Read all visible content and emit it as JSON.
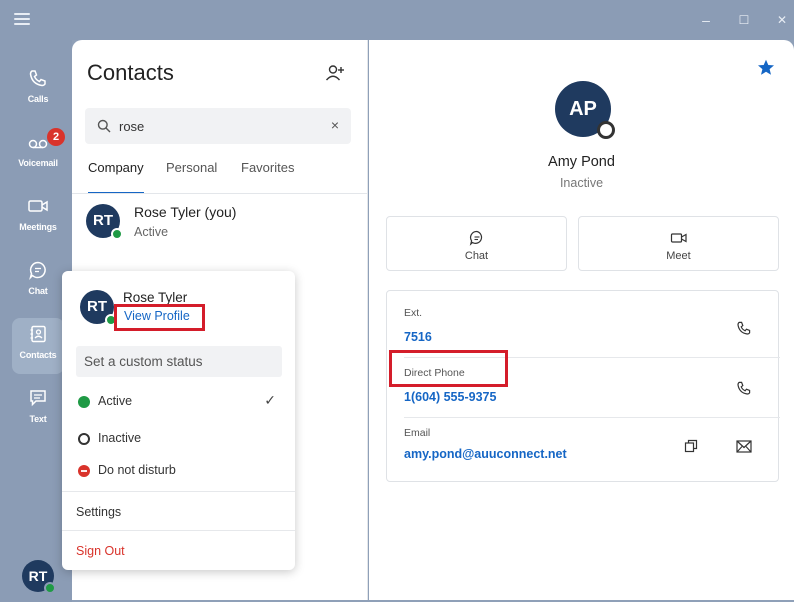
{
  "window": {
    "controls": {
      "minimize": "–",
      "maximize": "☐",
      "close": "✕"
    }
  },
  "rail": {
    "items": [
      {
        "label": "Calls",
        "icon": "phone-icon"
      },
      {
        "label": "Voicemail",
        "icon": "voicemail-icon",
        "badge": "2"
      },
      {
        "label": "Meetings",
        "icon": "video-icon"
      },
      {
        "label": "Chat",
        "icon": "chat-icon"
      },
      {
        "label": "Contacts",
        "icon": "contacts-icon",
        "active": true
      },
      {
        "label": "Text",
        "icon": "text-icon"
      }
    ],
    "user_initials": "RT"
  },
  "contacts": {
    "title": "Contacts",
    "search": {
      "value": "rose",
      "clear": "×"
    },
    "tabs": [
      "Company",
      "Personal",
      "Favorites"
    ],
    "active_tab": "Company",
    "list": [
      {
        "initials": "RT",
        "name": "Rose Tyler (you)",
        "status": "Active"
      }
    ]
  },
  "popup": {
    "initials": "RT",
    "name": "Rose Tyler",
    "view_profile": "View Profile",
    "custom_status_placeholder": "Set a custom status",
    "statuses": [
      {
        "label": "Active",
        "color": "#1f9a45",
        "checked": "✓"
      },
      {
        "label": "Inactive",
        "color": "#ffffff"
      },
      {
        "label": "Do not disturb",
        "color": "#d9332b"
      }
    ],
    "settings": "Settings",
    "sign_out": "Sign Out"
  },
  "detail": {
    "initials": "AP",
    "name": "Amy Pond",
    "status": "Inactive",
    "actions": [
      {
        "label": "Chat",
        "icon": "chat-icon"
      },
      {
        "label": "Meet",
        "icon": "video-icon"
      }
    ],
    "fields": [
      {
        "label": "Ext.",
        "value": "7516"
      },
      {
        "label": "Direct Phone",
        "value": "1(604) 555-9375"
      },
      {
        "label": "Email",
        "value": "amy.pond@auuconnect.net"
      }
    ]
  },
  "colors": {
    "accent": "#1566c5",
    "navy": "#1f3a5f",
    "highlight": "#d41d2a",
    "active_green": "#1f9a45",
    "badge_red": "#d9332b"
  }
}
